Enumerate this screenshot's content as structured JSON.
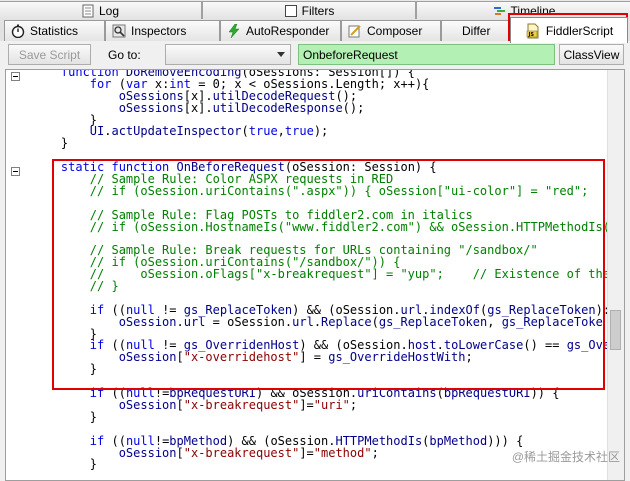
{
  "tabs_row1": [
    {
      "label": "Log",
      "icon": "log-icon"
    },
    {
      "label": "Filters",
      "icon": "filters-checkbox-icon"
    },
    {
      "label": "Timeline",
      "icon": "timeline-icon"
    }
  ],
  "tabs_row2": [
    {
      "label": "Statistics",
      "icon": "stopwatch-icon"
    },
    {
      "label": "Inspectors",
      "icon": "inspectors-icon"
    },
    {
      "label": "AutoResponder",
      "icon": "lightning-icon"
    },
    {
      "label": "Composer",
      "icon": "composer-icon"
    },
    {
      "label": "Differ",
      "icon": ""
    },
    {
      "label": "FiddlerScript",
      "icon": "js-file-icon"
    }
  ],
  "toolbar": {
    "save_label": "Save Script",
    "goto_label": "Go to:",
    "goto_value": "",
    "function_value": "OnbeforeRequest",
    "classview_label": "ClassView"
  },
  "code_lines": [
    [
      [
        "kw",
        "    function "
      ],
      [
        "id",
        "DoRemoveEncoding"
      ],
      [
        "op",
        "(oSessions: Session[]) {"
      ]
    ],
    [
      [
        "kw",
        "        for "
      ],
      [
        "op",
        "("
      ],
      [
        "kw",
        "var "
      ],
      [
        "op",
        "x:"
      ],
      [
        "kw",
        "int"
      ],
      [
        "op",
        " = 0; x < oSessions.Length; x++){"
      ]
    ],
    [
      [
        "id",
        "            oSessions"
      ],
      [
        "op",
        "[x]."
      ],
      [
        "id",
        "utilDecodeRequest"
      ],
      [
        "op",
        "();"
      ]
    ],
    [
      [
        "id",
        "            oSessions"
      ],
      [
        "op",
        "[x]."
      ],
      [
        "id",
        "utilDecodeResponse"
      ],
      [
        "op",
        "();"
      ]
    ],
    [
      [
        "op",
        "        }"
      ]
    ],
    [
      [
        "id",
        "        UI"
      ],
      [
        "op",
        "."
      ],
      [
        "id",
        "actUpdateInspector"
      ],
      [
        "op",
        "("
      ],
      [
        "kw",
        "true"
      ],
      [
        "op",
        ","
      ],
      [
        "kw",
        "true"
      ],
      [
        "op",
        ");"
      ]
    ],
    [
      [
        "op",
        "    }"
      ]
    ],
    [
      [
        "op",
        ""
      ]
    ],
    [
      [
        "kw",
        "    static function "
      ],
      [
        "id",
        "OnBeforeRequest"
      ],
      [
        "op",
        "(oSession: Session) {"
      ]
    ],
    [
      [
        "cm",
        "        // Sample Rule: Color ASPX requests in RED"
      ]
    ],
    [
      [
        "cm",
        "        // if (oSession.uriContains(\".aspx\")) { oSession[\"ui-color\"] = \"red\";"
      ]
    ],
    [
      [
        "op",
        ""
      ]
    ],
    [
      [
        "cm",
        "        // Sample Rule: Flag POSTs to fiddler2.com in italics"
      ]
    ],
    [
      [
        "cm",
        "        // if (oSession.HostnameIs(\"www.fiddler2.com\") && oSession.HTTPMethodIs("
      ]
    ],
    [
      [
        "op",
        ""
      ]
    ],
    [
      [
        "cm",
        "        // Sample Rule: Break requests for URLs containing \"/sandbox/\""
      ]
    ],
    [
      [
        "cm",
        "        // if (oSession.uriContains(\"/sandbox/\")) {"
      ]
    ],
    [
      [
        "cm",
        "        //     oSession.oFlags[\"x-breakrequest\"] = \"yup\";    // Existence of the"
      ]
    ],
    [
      [
        "cm",
        "        // }"
      ]
    ],
    [
      [
        "op",
        ""
      ]
    ],
    [
      [
        "kw",
        "        if "
      ],
      [
        "op",
        "(("
      ],
      [
        "kw",
        "null"
      ],
      [
        "op",
        " != "
      ],
      [
        "id",
        "gs_ReplaceToken"
      ],
      [
        "op",
        ") && (oSession."
      ],
      [
        "id",
        "url"
      ],
      [
        "op",
        "."
      ],
      [
        "id",
        "indexOf"
      ],
      [
        "op",
        "("
      ],
      [
        "id",
        "gs_ReplaceToken"
      ],
      [
        "op",
        "):"
      ]
    ],
    [
      [
        "id",
        "            oSession"
      ],
      [
        "op",
        "."
      ],
      [
        "id",
        "url"
      ],
      [
        "op",
        " = oSession."
      ],
      [
        "id",
        "url"
      ],
      [
        "op",
        "."
      ],
      [
        "id",
        "Replace"
      ],
      [
        "op",
        "("
      ],
      [
        "id",
        "gs_ReplaceToken"
      ],
      [
        "op",
        ", "
      ],
      [
        "id",
        "gs_ReplaceToke"
      ]
    ],
    [
      [
        "op",
        "        }"
      ]
    ],
    [
      [
        "kw",
        "        if "
      ],
      [
        "op",
        "(("
      ],
      [
        "kw",
        "null"
      ],
      [
        "op",
        " != "
      ],
      [
        "id",
        "gs_OverridenHost"
      ],
      [
        "op",
        ") && (oSession."
      ],
      [
        "id",
        "host"
      ],
      [
        "op",
        "."
      ],
      [
        "id",
        "toLowerCase"
      ],
      [
        "op",
        "() == "
      ],
      [
        "id",
        "gs_Ove"
      ]
    ],
    [
      [
        "id",
        "            oSession"
      ],
      [
        "op",
        "["
      ],
      [
        "st",
        "\"x-overridehost\""
      ],
      [
        "op",
        "] = "
      ],
      [
        "id",
        "gs_OverrideHostWith"
      ],
      [
        "op",
        ";"
      ]
    ],
    [
      [
        "op",
        "        }"
      ]
    ],
    [
      [
        "op",
        ""
      ]
    ],
    [
      [
        "kw",
        "        if "
      ],
      [
        "op",
        "(("
      ],
      [
        "kw",
        "null"
      ],
      [
        "op",
        "!="
      ],
      [
        "id",
        "bpRequestURI"
      ],
      [
        "op",
        ") && oSession."
      ],
      [
        "id",
        "uriContains"
      ],
      [
        "op",
        "("
      ],
      [
        "id",
        "bpRequestURI"
      ],
      [
        "op",
        ")) {"
      ]
    ],
    [
      [
        "id",
        "            oSession"
      ],
      [
        "op",
        "["
      ],
      [
        "st",
        "\"x-breakrequest\""
      ],
      [
        "op",
        "]="
      ],
      [
        "st",
        "\"uri\""
      ],
      [
        "op",
        ";"
      ]
    ],
    [
      [
        "op",
        "        }"
      ]
    ],
    [
      [
        "op",
        ""
      ]
    ],
    [
      [
        "kw",
        "        if "
      ],
      [
        "op",
        "(("
      ],
      [
        "kw",
        "null"
      ],
      [
        "op",
        "!="
      ],
      [
        "id",
        "bpMethod"
      ],
      [
        "op",
        ") && (oSession."
      ],
      [
        "id",
        "HTTPMethodIs"
      ],
      [
        "op",
        "("
      ],
      [
        "id",
        "bpMethod"
      ],
      [
        "op",
        "))) {"
      ]
    ],
    [
      [
        "id",
        "            oSession"
      ],
      [
        "op",
        "["
      ],
      [
        "st",
        "\"x-breakrequest\""
      ],
      [
        "op",
        "]="
      ],
      [
        "st",
        "\"method\""
      ],
      [
        "op",
        ";"
      ]
    ],
    [
      [
        "op",
        "        }"
      ]
    ]
  ],
  "watermark": "@稀土掘金技术社区",
  "colors": {
    "keyword": "#0000e6",
    "identifier": "#00008b",
    "comment": "#008000",
    "string": "#8b0000",
    "highlight_box": "#e00000",
    "function_box_bg": "#b3f0b3"
  }
}
